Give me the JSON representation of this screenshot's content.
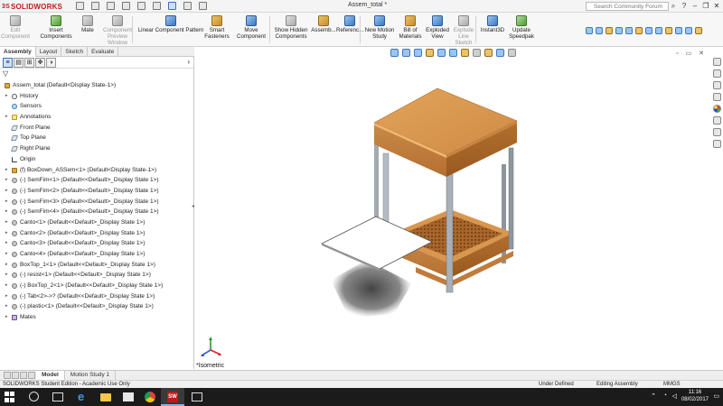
{
  "app": {
    "brand": "SOLIDWORKS",
    "document_title": "Assem_total *",
    "search_placeholder": "Search Community Forum"
  },
  "commands": [
    {
      "label": "Edit\nComponent",
      "icon": "edit-component-icon",
      "enabled": false
    },
    {
      "label": "Insert Components",
      "icon": "insert-components-icon",
      "enabled": true
    },
    {
      "label": "Mate",
      "icon": "mate-icon",
      "enabled": true
    },
    {
      "label": "Component\nPreview Window",
      "icon": "preview-window-icon",
      "enabled": false
    },
    {
      "label": "Linear Component Pattern",
      "icon": "linear-pattern-icon",
      "enabled": true
    },
    {
      "label": "Smart\nFasteners",
      "icon": "smart-fasteners-icon",
      "enabled": true
    },
    {
      "label": "Move Component",
      "icon": "move-component-icon",
      "enabled": true
    },
    {
      "label": "Show Hidden\nComponents",
      "icon": "show-hidden-icon",
      "enabled": true
    },
    {
      "label": "Assemb...",
      "icon": "assembly-features-icon",
      "enabled": true
    },
    {
      "label": "Referenc...",
      "icon": "reference-geometry-icon",
      "enabled": true
    },
    {
      "label": "New Motion\nStudy",
      "icon": "motion-study-icon",
      "enabled": true
    },
    {
      "label": "Bill of\nMaterials",
      "icon": "bom-icon",
      "enabled": true
    },
    {
      "label": "Exploded\nView",
      "icon": "exploded-view-icon",
      "enabled": true
    },
    {
      "label": "Explode\nLine Sketch",
      "icon": "explode-line-icon",
      "enabled": false
    },
    {
      "label": "Instant3D",
      "icon": "instant3d-icon",
      "enabled": true
    },
    {
      "label": "Update\nSpeedpak",
      "icon": "speedpak-icon",
      "enabled": true
    }
  ],
  "tabs": [
    "Assembly",
    "Layout",
    "Sketch",
    "Evaluate"
  ],
  "tree": [
    {
      "label": "Assem_total  (Default<Display State-1>)",
      "icon": "asm",
      "level": 0,
      "expander": false
    },
    {
      "label": "History",
      "icon": "hist",
      "level": 1,
      "expander": true
    },
    {
      "label": "Sensors",
      "icon": "sens",
      "level": 1,
      "expander": false
    },
    {
      "label": "Annotations",
      "icon": "annot",
      "level": 1,
      "expander": true
    },
    {
      "label": "Front Plane",
      "icon": "plane",
      "level": 1,
      "expander": false
    },
    {
      "label": "Top Plane",
      "icon": "plane",
      "level": 1,
      "expander": false
    },
    {
      "label": "Right Plane",
      "icon": "plane",
      "level": 1,
      "expander": false
    },
    {
      "label": "Origin",
      "icon": "origin",
      "level": 1,
      "expander": false
    },
    {
      "label": "(f) BoxDown_ASSem<1>  (Default<Display State-1>)",
      "icon": "asm",
      "level": 1,
      "expander": true
    },
    {
      "label": "(-) SemFim<1>  (Default<<Default>_Display State 1>)",
      "icon": "part",
      "level": 1,
      "expander": true
    },
    {
      "label": "(-) SemFim<2>  (Default<<Default>_Display State 1>)",
      "icon": "part",
      "level": 1,
      "expander": true
    },
    {
      "label": "(-) SemFim<3>  (Default<<Default>_Display State 1>)",
      "icon": "part",
      "level": 1,
      "expander": true
    },
    {
      "label": "(-) SemFim<4>  (Default<<Default>_Display State 1>)",
      "icon": "part",
      "level": 1,
      "expander": true
    },
    {
      "label": "Canto<1>  (Default<<Default>_Display State 1>)",
      "icon": "part",
      "level": 1,
      "expander": true
    },
    {
      "label": "Canto<2>  (Default<<Default>_Display State 1>)",
      "icon": "part",
      "level": 1,
      "expander": true
    },
    {
      "label": "Canto<3>  (Default<<Default>_Display State 1>)",
      "icon": "part",
      "level": 1,
      "expander": true
    },
    {
      "label": "Canto<4>  (Default<<Default>_Display State 1>)",
      "icon": "part",
      "level": 1,
      "expander": true
    },
    {
      "label": "BoxTop_1<1>  (Default<<Default>_Display State 1>)",
      "icon": "part",
      "level": 1,
      "expander": true
    },
    {
      "label": "(-) resist<1>  (Default<<Default>_Display State 1>)",
      "icon": "part",
      "level": 1,
      "expander": true
    },
    {
      "label": "(-) BoxTop_2<1>  (Default<<Default>_Display State 1>)",
      "icon": "part",
      "level": 1,
      "expander": true
    },
    {
      "label": "(-) Tab<2>->?  (Default<<Default>_Display State 1>)",
      "icon": "part",
      "level": 1,
      "expander": true
    },
    {
      "label": "(-) plastic<1>  (Default<<Default>_Display State 1>)",
      "icon": "part",
      "level": 1,
      "expander": true
    },
    {
      "label": "Mates",
      "icon": "mate",
      "level": 1,
      "expander": true
    }
  ],
  "viewport": {
    "view_name": "*Isometric"
  },
  "bottom_tabs": [
    "Model",
    "Motion Study 1"
  ],
  "status": {
    "edition": "SOLIDWORKS Student Edition - Academic Use Only",
    "state": "Under Defined",
    "mode": "Editing Assembly",
    "units": "MMGS"
  },
  "clock": {
    "time": "11:16",
    "date": "08/02/2017"
  },
  "colors": {
    "wood_top": "#d99850",
    "wood_side": "#c0783a",
    "wood_dark": "#a45e26",
    "leg": "#9aa1a8",
    "accent": "#3a78c2"
  }
}
